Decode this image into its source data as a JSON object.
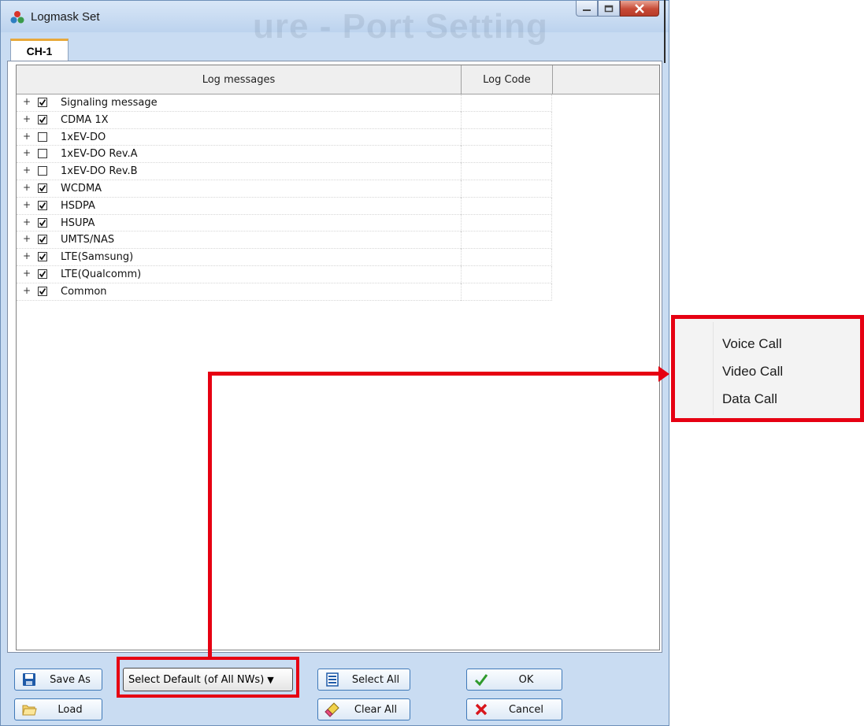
{
  "window": {
    "title": "Logmask Set",
    "background_title": "ure - Port Setting"
  },
  "tabs": [
    {
      "label": "CH-1",
      "active": true
    }
  ],
  "grid": {
    "columns": [
      "Log messages",
      "Log Code"
    ],
    "rows": [
      {
        "expander": "+",
        "checked": true,
        "label": "Signaling message",
        "code": ""
      },
      {
        "expander": "+",
        "checked": true,
        "label": "CDMA 1X",
        "code": ""
      },
      {
        "expander": "+",
        "checked": false,
        "label": "1xEV-DO",
        "code": ""
      },
      {
        "expander": "+",
        "checked": false,
        "label": "1xEV-DO Rev.A",
        "code": ""
      },
      {
        "expander": "+",
        "checked": false,
        "label": "1xEV-DO Rev.B",
        "code": ""
      },
      {
        "expander": "+",
        "checked": true,
        "label": "WCDMA",
        "code": ""
      },
      {
        "expander": "+",
        "checked": true,
        "label": "HSDPA",
        "code": ""
      },
      {
        "expander": "+",
        "checked": true,
        "label": "HSUPA",
        "code": ""
      },
      {
        "expander": "+",
        "checked": true,
        "label": "UMTS/NAS",
        "code": ""
      },
      {
        "expander": "+",
        "checked": true,
        "label": "LTE(Samsung)",
        "code": ""
      },
      {
        "expander": "+",
        "checked": true,
        "label": "LTE(Qualcomm)",
        "code": ""
      },
      {
        "expander": "+",
        "checked": true,
        "label": "Common",
        "code": ""
      }
    ]
  },
  "buttons": {
    "save_as": {
      "label": "Save As",
      "icon": "floppy-disk-icon"
    },
    "load": {
      "label": "Load",
      "icon": "folder-open-icon"
    },
    "select_default": {
      "label": "Select Default (of All NWs)",
      "icon": "caret-down-icon"
    },
    "select_all": {
      "label": "Select All",
      "icon": "list-icon"
    },
    "clear_all": {
      "label": "Clear All",
      "icon": "eraser-icon"
    },
    "ok": {
      "label": "OK",
      "icon": "checkmark-icon"
    },
    "cancel": {
      "label": "Cancel",
      "icon": "x-icon"
    }
  },
  "popup_menu": {
    "items": [
      "Voice Call",
      "Video Call",
      "Data Call"
    ]
  },
  "colors": {
    "annotation_red": "#e60012",
    "button_border": "#3f79b8",
    "tab_accent": "#e8a93a"
  }
}
